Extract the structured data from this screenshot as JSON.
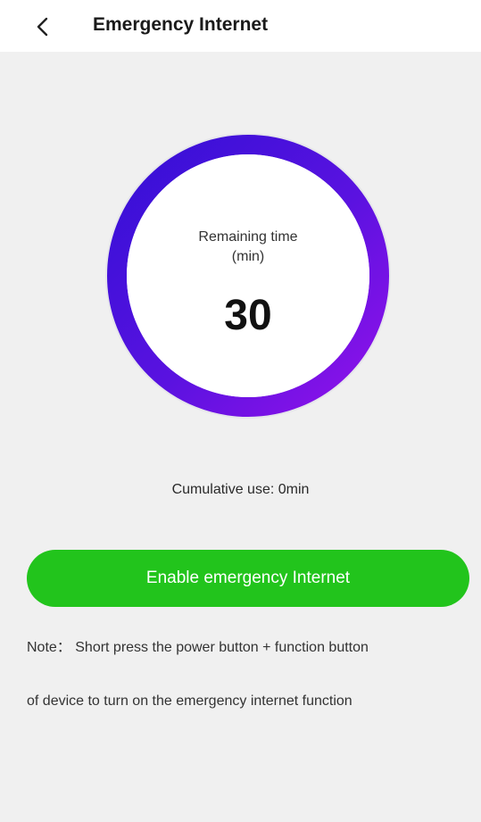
{
  "header": {
    "back_icon": "chevron-left-icon",
    "title": "Emergency Internet"
  },
  "timer": {
    "label_line1": "Remaining time",
    "label_line2": "(min)",
    "value": "30",
    "ring_colors": {
      "start": "#3a10d8",
      "end": "#8a12e8",
      "track": "#e4e4e8",
      "inner": "#ffffff"
    }
  },
  "cumulative": {
    "text": "Cumulative use: 0min"
  },
  "actions": {
    "enable_label": "Enable emergency Internet",
    "enable_color": "#22c41c"
  },
  "note": {
    "line1": "Note： Short press the power button + function button",
    "line2": "of device to turn on the emergency internet function"
  }
}
